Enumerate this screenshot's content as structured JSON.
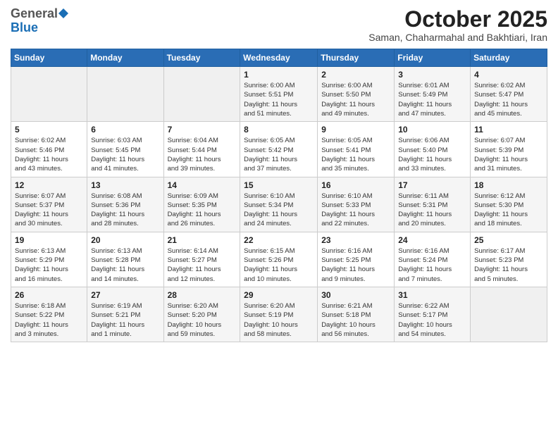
{
  "header": {
    "logo_general": "General",
    "logo_blue": "Blue",
    "month_title": "October 2025",
    "subtitle": "Saman, Chaharmahal and Bakhtiari, Iran"
  },
  "weekdays": [
    "Sunday",
    "Monday",
    "Tuesday",
    "Wednesday",
    "Thursday",
    "Friday",
    "Saturday"
  ],
  "weeks": [
    [
      {
        "day": "",
        "info": ""
      },
      {
        "day": "",
        "info": ""
      },
      {
        "day": "",
        "info": ""
      },
      {
        "day": "1",
        "info": "Sunrise: 6:00 AM\nSunset: 5:51 PM\nDaylight: 11 hours\nand 51 minutes."
      },
      {
        "day": "2",
        "info": "Sunrise: 6:00 AM\nSunset: 5:50 PM\nDaylight: 11 hours\nand 49 minutes."
      },
      {
        "day": "3",
        "info": "Sunrise: 6:01 AM\nSunset: 5:49 PM\nDaylight: 11 hours\nand 47 minutes."
      },
      {
        "day": "4",
        "info": "Sunrise: 6:02 AM\nSunset: 5:47 PM\nDaylight: 11 hours\nand 45 minutes."
      }
    ],
    [
      {
        "day": "5",
        "info": "Sunrise: 6:02 AM\nSunset: 5:46 PM\nDaylight: 11 hours\nand 43 minutes."
      },
      {
        "day": "6",
        "info": "Sunrise: 6:03 AM\nSunset: 5:45 PM\nDaylight: 11 hours\nand 41 minutes."
      },
      {
        "day": "7",
        "info": "Sunrise: 6:04 AM\nSunset: 5:44 PM\nDaylight: 11 hours\nand 39 minutes."
      },
      {
        "day": "8",
        "info": "Sunrise: 6:05 AM\nSunset: 5:42 PM\nDaylight: 11 hours\nand 37 minutes."
      },
      {
        "day": "9",
        "info": "Sunrise: 6:05 AM\nSunset: 5:41 PM\nDaylight: 11 hours\nand 35 minutes."
      },
      {
        "day": "10",
        "info": "Sunrise: 6:06 AM\nSunset: 5:40 PM\nDaylight: 11 hours\nand 33 minutes."
      },
      {
        "day": "11",
        "info": "Sunrise: 6:07 AM\nSunset: 5:39 PM\nDaylight: 11 hours\nand 31 minutes."
      }
    ],
    [
      {
        "day": "12",
        "info": "Sunrise: 6:07 AM\nSunset: 5:37 PM\nDaylight: 11 hours\nand 30 minutes."
      },
      {
        "day": "13",
        "info": "Sunrise: 6:08 AM\nSunset: 5:36 PM\nDaylight: 11 hours\nand 28 minutes."
      },
      {
        "day": "14",
        "info": "Sunrise: 6:09 AM\nSunset: 5:35 PM\nDaylight: 11 hours\nand 26 minutes."
      },
      {
        "day": "15",
        "info": "Sunrise: 6:10 AM\nSunset: 5:34 PM\nDaylight: 11 hours\nand 24 minutes."
      },
      {
        "day": "16",
        "info": "Sunrise: 6:10 AM\nSunset: 5:33 PM\nDaylight: 11 hours\nand 22 minutes."
      },
      {
        "day": "17",
        "info": "Sunrise: 6:11 AM\nSunset: 5:31 PM\nDaylight: 11 hours\nand 20 minutes."
      },
      {
        "day": "18",
        "info": "Sunrise: 6:12 AM\nSunset: 5:30 PM\nDaylight: 11 hours\nand 18 minutes."
      }
    ],
    [
      {
        "day": "19",
        "info": "Sunrise: 6:13 AM\nSunset: 5:29 PM\nDaylight: 11 hours\nand 16 minutes."
      },
      {
        "day": "20",
        "info": "Sunrise: 6:13 AM\nSunset: 5:28 PM\nDaylight: 11 hours\nand 14 minutes."
      },
      {
        "day": "21",
        "info": "Sunrise: 6:14 AM\nSunset: 5:27 PM\nDaylight: 11 hours\nand 12 minutes."
      },
      {
        "day": "22",
        "info": "Sunrise: 6:15 AM\nSunset: 5:26 PM\nDaylight: 11 hours\nand 10 minutes."
      },
      {
        "day": "23",
        "info": "Sunrise: 6:16 AM\nSunset: 5:25 PM\nDaylight: 11 hours\nand 9 minutes."
      },
      {
        "day": "24",
        "info": "Sunrise: 6:16 AM\nSunset: 5:24 PM\nDaylight: 11 hours\nand 7 minutes."
      },
      {
        "day": "25",
        "info": "Sunrise: 6:17 AM\nSunset: 5:23 PM\nDaylight: 11 hours\nand 5 minutes."
      }
    ],
    [
      {
        "day": "26",
        "info": "Sunrise: 6:18 AM\nSunset: 5:22 PM\nDaylight: 11 hours\nand 3 minutes."
      },
      {
        "day": "27",
        "info": "Sunrise: 6:19 AM\nSunset: 5:21 PM\nDaylight: 11 hours\nand 1 minute."
      },
      {
        "day": "28",
        "info": "Sunrise: 6:20 AM\nSunset: 5:20 PM\nDaylight: 10 hours\nand 59 minutes."
      },
      {
        "day": "29",
        "info": "Sunrise: 6:20 AM\nSunset: 5:19 PM\nDaylight: 10 hours\nand 58 minutes."
      },
      {
        "day": "30",
        "info": "Sunrise: 6:21 AM\nSunset: 5:18 PM\nDaylight: 10 hours\nand 56 minutes."
      },
      {
        "day": "31",
        "info": "Sunrise: 6:22 AM\nSunset: 5:17 PM\nDaylight: 10 hours\nand 54 minutes."
      },
      {
        "day": "",
        "info": ""
      }
    ]
  ]
}
